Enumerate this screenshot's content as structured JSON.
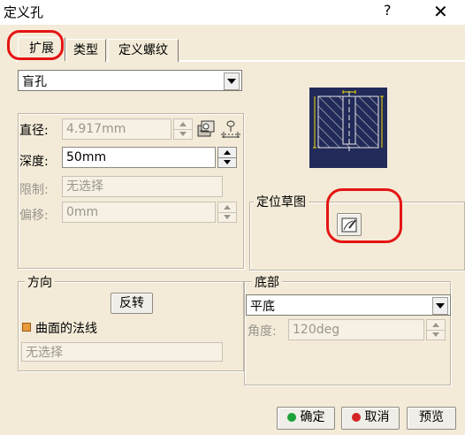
{
  "window": {
    "title": "定义孔",
    "help_glyph": "?",
    "close_glyph": "✕"
  },
  "tabs": [
    {
      "label": "扩展",
      "active": true
    },
    {
      "label": "类型",
      "active": false
    },
    {
      "label": "定义螺纹",
      "active": false
    }
  ],
  "extension": {
    "selected": "盲孔"
  },
  "params": {
    "diameter_label": "直径:",
    "diameter_value": "4.917mm",
    "depth_label": "深度:",
    "depth_value": "50mm",
    "limit_label": "限制:",
    "limit_placeholder": "无选择",
    "offset_label": "偏移:",
    "offset_value": "0mm"
  },
  "positioning": {
    "title": "定位草图"
  },
  "direction": {
    "title": "方向",
    "reverse_label": "反转",
    "normal_label": "曲面的法线",
    "selection_placeholder": "无选择"
  },
  "bottom": {
    "title": "底部",
    "selected": "平底",
    "angle_label": "角度:",
    "angle_value": "120deg"
  },
  "footer": {
    "ok_label": "确定",
    "cancel_label": "取消",
    "preview_label": "预览"
  },
  "colors": {
    "ok_dot": "#1aa33b",
    "cancel_dot": "#d42424",
    "annotation": "#e51414",
    "preview_bg": "#222a59"
  },
  "icons": [
    "help-icon",
    "close-icon",
    "sketch-icon",
    "thread-table-icon",
    "pattern-icon",
    "chevron-down-icon",
    "spin-icon"
  ]
}
